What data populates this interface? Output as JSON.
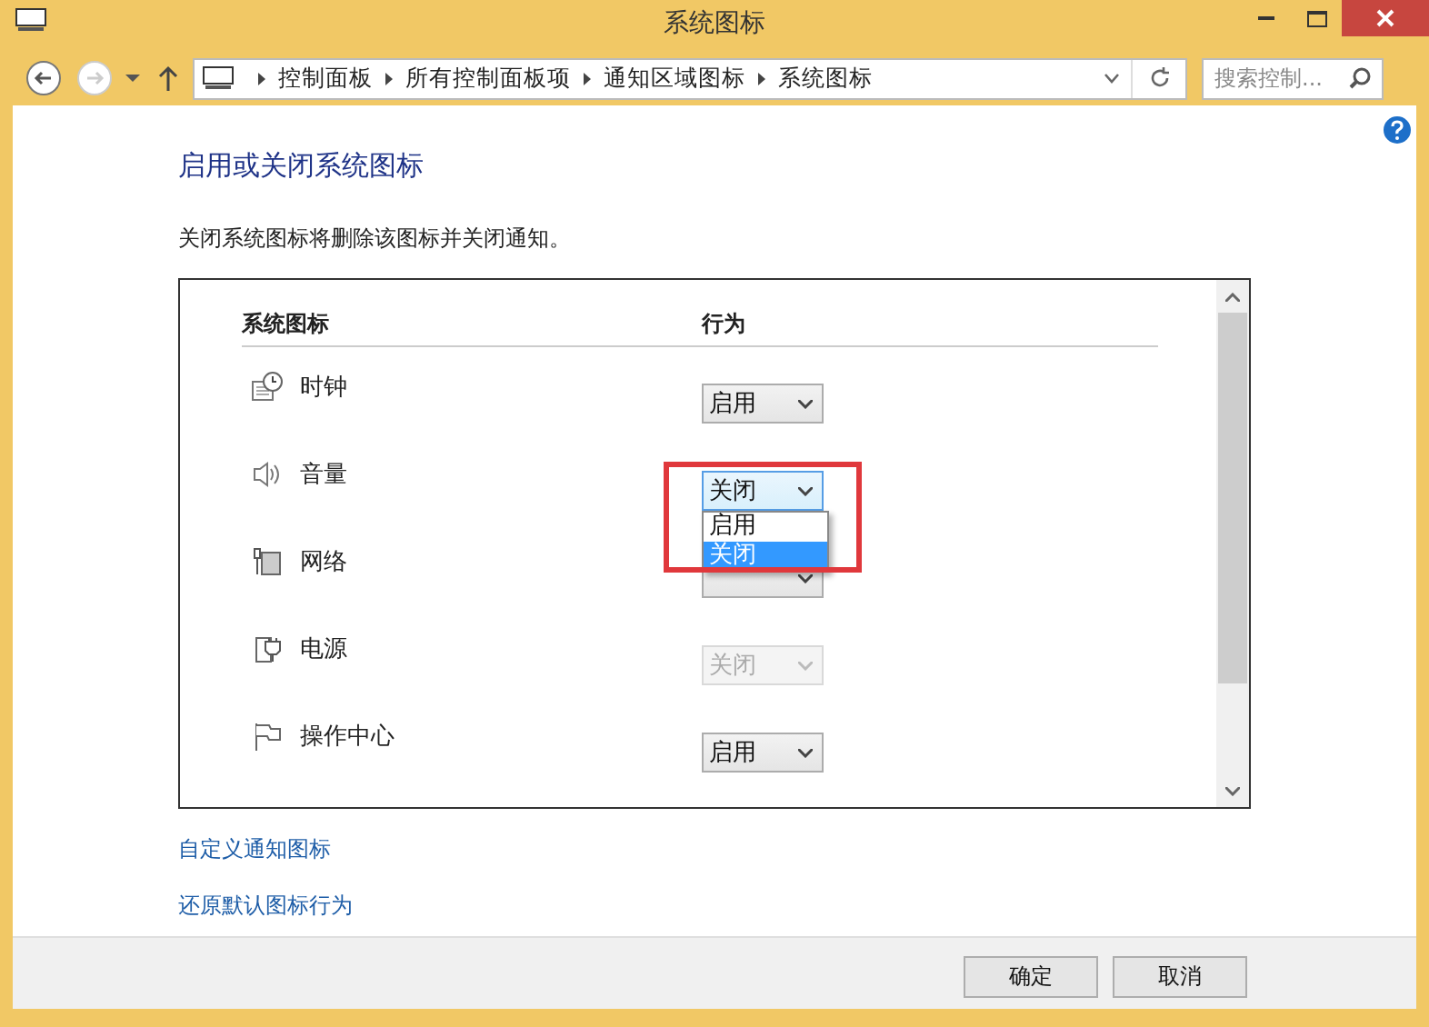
{
  "window": {
    "title": "系统图标"
  },
  "breadcrumb": [
    "控制面板",
    "所有控制面板项",
    "通知区域图标",
    "系统图标"
  ],
  "search": {
    "placeholder": "搜索控制..."
  },
  "heading": "启用或关闭系统图标",
  "description": "关闭系统图标将删除该图标并关闭通知。",
  "table": {
    "columns": [
      "系统图标",
      "行为"
    ],
    "rows": [
      {
        "kind": "clock",
        "name": "时钟",
        "value": "启用",
        "disabled": false,
        "expanded": false
      },
      {
        "kind": "speaker",
        "name": "音量",
        "value": "关闭",
        "disabled": false,
        "expanded": true,
        "options": [
          {
            "label": "启用",
            "selected": false
          },
          {
            "label": "关闭",
            "selected": true
          }
        ]
      },
      {
        "kind": "network",
        "name": "网络",
        "disabled": false,
        "expanded": false
      },
      {
        "kind": "power",
        "name": "电源",
        "value": "关闭",
        "disabled": true,
        "expanded": false
      },
      {
        "kind": "flag",
        "name": "操作中心",
        "value": "启用",
        "disabled": false,
        "expanded": false
      }
    ]
  },
  "links": [
    "自定义通知图标",
    "还原默认图标行为"
  ],
  "buttons": [
    "确定",
    "取消"
  ]
}
